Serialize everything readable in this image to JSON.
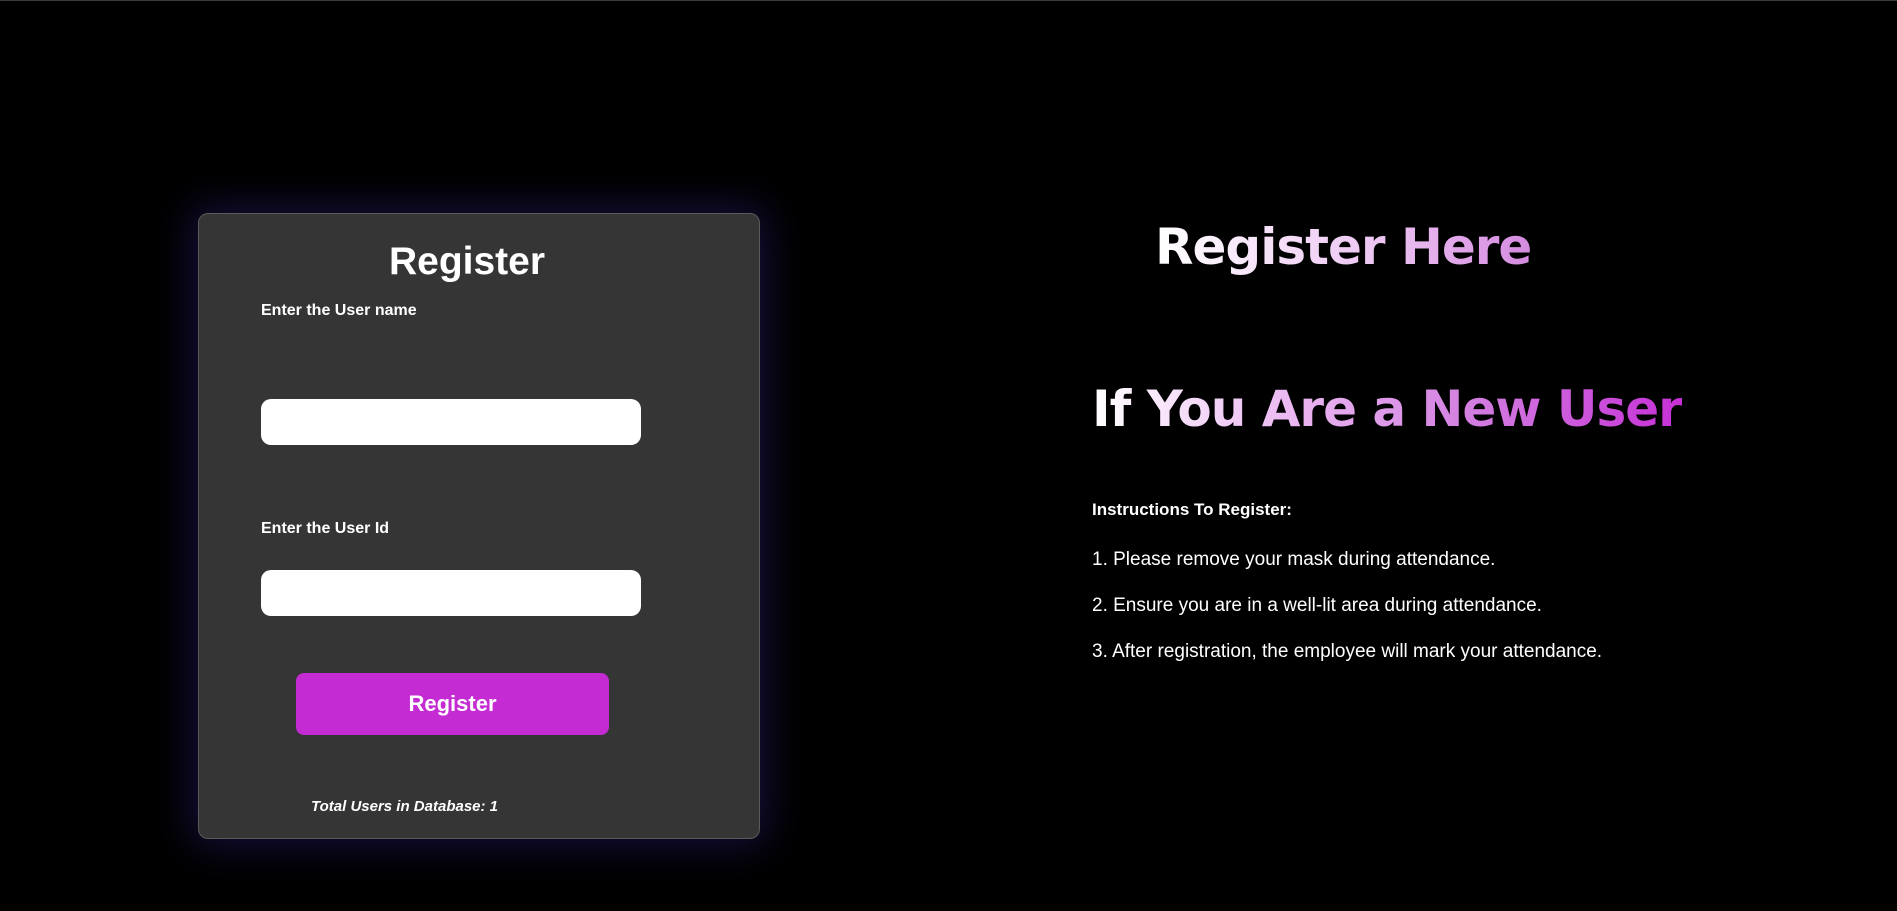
{
  "form": {
    "title": "Register",
    "username_label": "Enter the User name",
    "username_value": "",
    "userid_label": "Enter the User Id",
    "userid_value": "",
    "submit_label": "Register",
    "total_users_text": "Total Users in Database: 1"
  },
  "hero": {
    "title": "Register Here",
    "subtitle": "If You Are a New User"
  },
  "instructions": {
    "heading": "Instructions To Register:",
    "items": [
      "1. Please remove your mask during attendance.",
      "2. Ensure you are in a well-lit area during attendance.",
      "3. After registration, the employee will mark your attendance."
    ]
  },
  "colors": {
    "background": "#000000",
    "card": "#353535",
    "accent": "#c42bd2",
    "input": "#ffffff"
  }
}
